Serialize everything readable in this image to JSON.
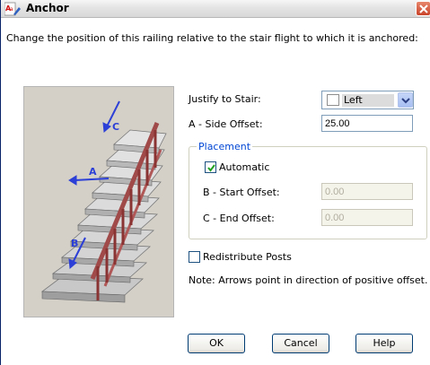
{
  "window": {
    "title": "Anchor",
    "icon": "autocad-architecture-app-icon"
  },
  "instruction": "Change the position of this railing relative to the stair flight to which it is anchored:",
  "preview": {
    "labels": {
      "a": "A",
      "b": "B",
      "c": "C"
    },
    "arrow_color": "#2c3fd6",
    "railing_color": "#a04a4a"
  },
  "justify": {
    "label": "Justify to Stair:",
    "value": "Left"
  },
  "side_offset": {
    "label": "A - Side Offset:",
    "value": "25.00"
  },
  "placement": {
    "legend": "Placement",
    "automatic_label": "Automatic",
    "automatic_checked": true,
    "start_offset_label": "B - Start Offset:",
    "start_offset_value": "0.00",
    "end_offset_label": "C - End Offset:",
    "end_offset_value": "0.00"
  },
  "redistribute": {
    "label": "Redistribute Posts",
    "checked": false
  },
  "note": "Note: Arrows point in direction of positive offset.",
  "buttons": {
    "ok": "OK",
    "cancel": "Cancel",
    "help": "Help"
  }
}
